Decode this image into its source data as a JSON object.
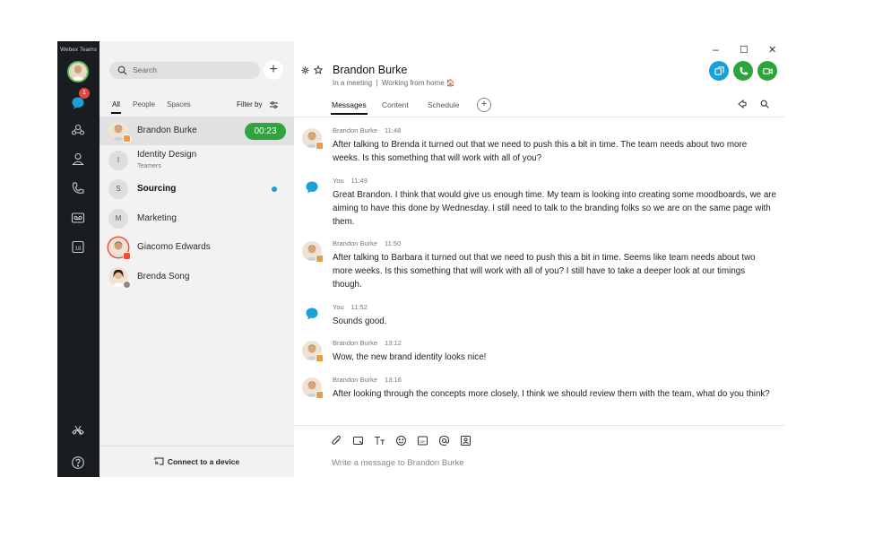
{
  "app": {
    "title": "Webex Teams",
    "unread_badge": "1"
  },
  "rail": {
    "icons": [
      "avatar",
      "messages-icon",
      "teams-icon",
      "contacts-icon",
      "calls-icon",
      "voicemail-icon",
      "calendar-icon",
      "help-icon"
    ]
  },
  "list": {
    "search_placeholder": "Search",
    "tabs": [
      "All",
      "People",
      "Spaces"
    ],
    "filter_label": "Filter by",
    "contacts": [
      {
        "name": "Brandon Burke",
        "initial": "",
        "sub": "",
        "timer": "00:23"
      },
      {
        "name": "Identity Design",
        "initial": "I",
        "sub": "Teamers"
      },
      {
        "name": "Sourcing",
        "initial": "S",
        "sub": ""
      },
      {
        "name": "Marketing",
        "initial": "M",
        "sub": ""
      },
      {
        "name": "Giacomo Edwards",
        "initial": "",
        "sub": ""
      },
      {
        "name": "Brenda Song",
        "initial": "",
        "sub": ""
      }
    ],
    "connect_label": "Connect to a device"
  },
  "main": {
    "title": "Brandon Burke",
    "status_left": "In a meeting",
    "status_right": "Working from home 🏠",
    "tabs": [
      "Messages",
      "Content",
      "Schedule"
    ],
    "messages": [
      {
        "author": "Brandon Burke",
        "time": "11:48",
        "text": "After talking to Brenda it turned out that we need to push this a bit in time. The team needs about two more weeks. Is this something that will work with all of you?"
      },
      {
        "author": "You",
        "time": "11:49",
        "text": "Great Brandon. I think that would give us enough time. My team is looking into creating some moodboards, we are aiming to have this done by Wednesday. I still need to talk to the branding folks so we are on the same page with them."
      },
      {
        "author": "Brandon Burke",
        "time": "11:50",
        "text": "After talking to Barbara it turned out that we need to push this a bit in time. Seems like team needs about two more weeks. Is this something that will work with all of you? I still have to take a deeper look at our timings though."
      },
      {
        "author": "You",
        "time": "11:52",
        "text": "Sounds good."
      },
      {
        "author": "Brandon Burke",
        "time": "13:12",
        "text": "Wow, the new brand identity looks nice!"
      },
      {
        "author": "Brandon Burke",
        "time": "13:16",
        "text": "After looking through the concepts more closely, I think we should review them with the team, what do you think?"
      }
    ],
    "composer_placeholder": "Write a message to Brandon Burke",
    "colors": {
      "call_share": "#1a9fd6",
      "call_audio": "#2ea43c",
      "call_video": "#2ea43c",
      "active_timer": "#2ea43c"
    }
  }
}
